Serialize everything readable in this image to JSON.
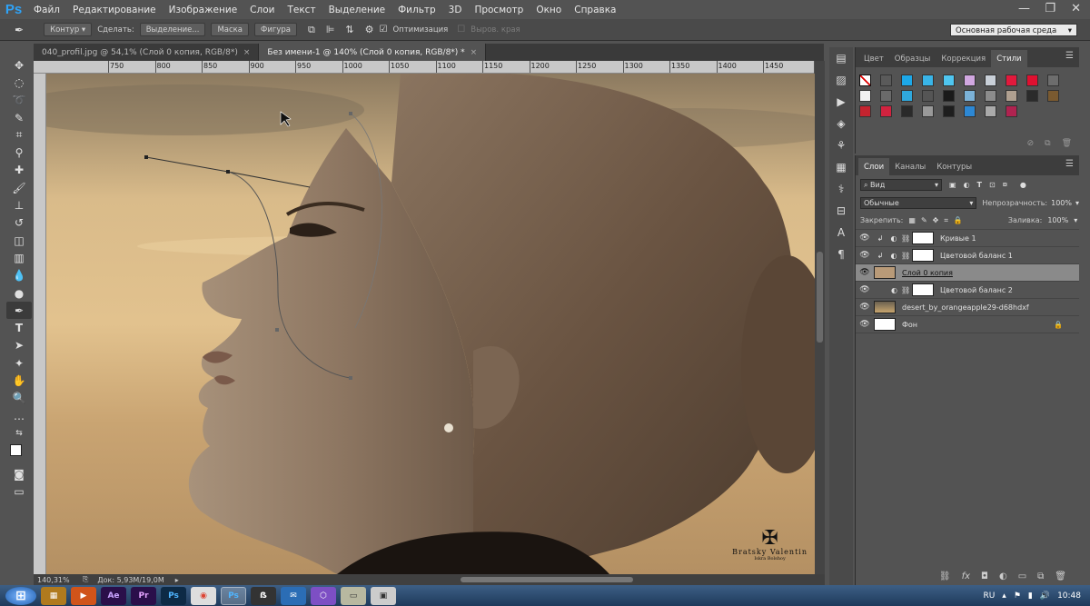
{
  "app": {
    "logo": "Ps"
  },
  "menu": [
    "Файл",
    "Редактирование",
    "Изображение",
    "Слои",
    "Текст",
    "Выделение",
    "Фильтр",
    "3D",
    "Просмотр",
    "Окно",
    "Справка"
  ],
  "window_controls": {
    "minimize": "—",
    "maximize": "❐",
    "close": "✕"
  },
  "options": {
    "tool_mode": "Контур",
    "make": "Сделать:",
    "selection": "Выделение...",
    "mask": "Маска",
    "shape": "Фигура",
    "optimization": "Оптимизация",
    "align_edges": "Выров. края",
    "workspace": "Основная рабочая среда"
  },
  "tabs": [
    {
      "label": "040_profil.jpg @ 54,1% (Слой 0 копия, RGB/8*)",
      "close": "×"
    },
    {
      "label": "Без имени-1 @ 140% (Слой 0 копия, RGB/8*) *",
      "close": "×"
    }
  ],
  "ruler": {
    "h": [
      "750",
      "800",
      "850",
      "900",
      "950",
      "1000",
      "1050",
      "1100",
      "1150",
      "1200",
      "1250",
      "1300",
      "1350",
      "1400",
      "1450"
    ]
  },
  "status": {
    "zoom": "140,31%",
    "doc": "Док: 5,93M/19,0M"
  },
  "styles_panel": {
    "tabs": [
      "Цвет",
      "Образцы",
      "Коррекция",
      "Стили"
    ],
    "active_tab": "Стили",
    "swatches": [
      "#ffffff",
      "#5a5a5a",
      "#1da8e8",
      "#39b5e8",
      "#4fc6f0",
      "#d1a7e0",
      "#c9d0d8",
      "#e2193c",
      "#e01030",
      "#6d6d6d",
      "#f2f2f2",
      "#6a6a6a",
      "#2fa8dd",
      "#555555",
      "#1a1a1a",
      "#7bb2d8",
      "#8c8c8c",
      "#b0a090",
      "#2b2b2b",
      "#7a5a30",
      "#c4232f",
      "#d1233f",
      "#2a2a2a",
      "#999999",
      "#1e1e1e",
      "#2d88d4",
      "#aaaaaa",
      "#b02350"
    ]
  },
  "layers_panel": {
    "tabs": [
      "Слои",
      "Каналы",
      "Контуры"
    ],
    "filter": "Вид",
    "blend_mode": "Обычные",
    "opacity_label": "Непрозрачность:",
    "opacity": "100%",
    "lock_label": "Закрепить:",
    "fill_label": "Заливка:",
    "fill": "100%",
    "layers": [
      {
        "name": "Кривые 1",
        "selected": false
      },
      {
        "name": "Цветовой баланс 1",
        "selected": false
      },
      {
        "name": "Слой 0 копия",
        "selected": true
      },
      {
        "name": "Цветовой баланс 2",
        "selected": false
      },
      {
        "name": "desert_by_orangeapple29-d68hdxf",
        "selected": false
      },
      {
        "name": "Фон",
        "selected": false
      }
    ]
  },
  "watermark": {
    "line1": "Bratsky Valentin",
    "line2": "Iskra Bolshoy"
  },
  "taskbar": {
    "apps": [
      "⊞",
      "▦",
      "▶",
      "Ae",
      "Pr",
      "Ps",
      "◉",
      "Ps",
      "ẞ",
      "✉",
      "⬡",
      "▭",
      "▣"
    ],
    "lang": "RU",
    "clock": "10:48"
  }
}
